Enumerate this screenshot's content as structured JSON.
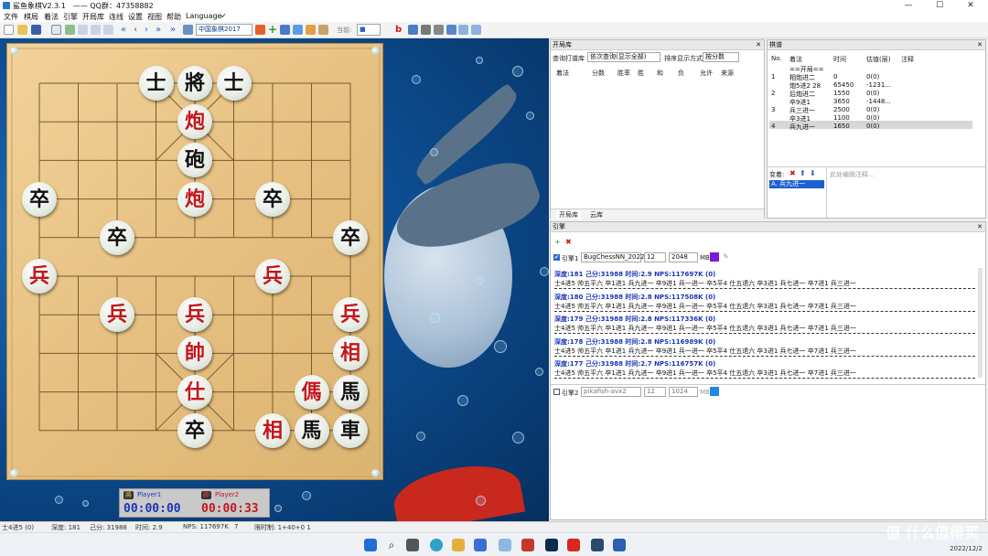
{
  "window": {
    "title": "鲨鱼象棋V2.3.1　——  QQ群：47358882",
    "minimize": "—",
    "maximize": "☐",
    "close": "✕"
  },
  "menu": [
    "文件",
    "棋局",
    "着法",
    "引擎",
    "开局库",
    "连线",
    "设置",
    "视图",
    "帮助",
    "Language"
  ],
  "toolbar": {
    "book_select": "中国象棋2017",
    "note_label": "当前:"
  },
  "board": {
    "pieces": [
      {
        "char": "士",
        "color": "black",
        "col": 3,
        "row": 0
      },
      {
        "char": "將",
        "color": "black",
        "col": 4,
        "row": 0
      },
      {
        "char": "士",
        "color": "black",
        "col": 5,
        "row": 0
      },
      {
        "char": "炮",
        "color": "red",
        "col": 4,
        "row": 1
      },
      {
        "char": "砲",
        "color": "black",
        "col": 4,
        "row": 2
      },
      {
        "char": "炮",
        "color": "red",
        "col": 4,
        "row": 3
      },
      {
        "char": "卒",
        "color": "black",
        "col": 0,
        "row": 3
      },
      {
        "char": "卒",
        "color": "black",
        "col": 6,
        "row": 3
      },
      {
        "char": "卒",
        "color": "black",
        "col": 2,
        "row": 4
      },
      {
        "char": "卒",
        "color": "black",
        "col": 8,
        "row": 4
      },
      {
        "char": "兵",
        "color": "red",
        "col": 0,
        "row": 5
      },
      {
        "char": "兵",
        "color": "red",
        "col": 6,
        "row": 5
      },
      {
        "char": "兵",
        "color": "red",
        "col": 2,
        "row": 6
      },
      {
        "char": "兵",
        "color": "red",
        "col": 4,
        "row": 6
      },
      {
        "char": "兵",
        "color": "red",
        "col": 8,
        "row": 6
      },
      {
        "char": "帥",
        "color": "red",
        "col": 4,
        "row": 7
      },
      {
        "char": "相",
        "color": "red",
        "col": 8,
        "row": 7
      },
      {
        "char": "仕",
        "color": "red",
        "col": 4,
        "row": 8
      },
      {
        "char": "傌",
        "color": "red",
        "col": 7,
        "row": 8
      },
      {
        "char": "馬",
        "color": "black",
        "col": 8,
        "row": 8
      },
      {
        "char": "卒",
        "color": "black",
        "col": 4,
        "row": 9
      },
      {
        "char": "相",
        "color": "red",
        "col": 6,
        "row": 9
      },
      {
        "char": "馬",
        "color": "black",
        "col": 7,
        "row": 9
      },
      {
        "char": "車",
        "color": "black",
        "col": 8,
        "row": 9
      }
    ]
  },
  "clocks": {
    "black_tag": "將",
    "black_name": "Player1",
    "black_time": "00:00:00",
    "red_tag": "帥",
    "red_name": "Player2",
    "red_time": "00:00:33"
  },
  "opening_panel": {
    "title": "开局库",
    "query_label": "查询打谱库",
    "query_mode": "依次查询(显示全部)",
    "sort_label": "排序显示方式",
    "sort_mode": "按分数",
    "columns": [
      "着法",
      "分数",
      "胜率",
      "胜",
      "和",
      "负",
      "允许",
      "来源"
    ],
    "tabs": [
      "开局库",
      "云库"
    ]
  },
  "manual_panel": {
    "title": "棋谱",
    "columns": [
      "No.",
      "着法",
      "时间",
      "估值(层)",
      "注释"
    ],
    "rows": [
      {
        "no": "",
        "move": "==开局==",
        "time": "",
        "eval": ""
      },
      {
        "no": "1",
        "move": "相炮进二",
        "time": "0",
        "eval": "0(0)"
      },
      {
        "no": "",
        "move": "炮5进2  28",
        "time": "65450",
        "eval": "-1231..."
      },
      {
        "no": "2",
        "move": "后炮进二",
        "time": "1550",
        "eval": "0(0)"
      },
      {
        "no": "",
        "move": "卒9进1",
        "time": "3650",
        "eval": "-1448..."
      },
      {
        "no": "3",
        "move": "兵三进一",
        "time": "2500",
        "eval": "0(0)"
      },
      {
        "no": "",
        "move": "卒3进1",
        "time": "1100",
        "eval": "0(0)"
      },
      {
        "no": "4",
        "move": "兵九进一",
        "time": "1650",
        "eval": "0(0)"
      }
    ],
    "variation_label": "变着:",
    "variation_item": "A. 兵九进一",
    "comment_placeholder": "此处编辑注释..."
  },
  "engine_panel": {
    "title": "引擎",
    "engine1": {
      "label": "引擎1",
      "name": "BugChessNN_2022",
      "threads": "12",
      "hash": "2048",
      "unit": "MB"
    },
    "engine2": {
      "label": "引擎2",
      "name": "pikafish-avx2",
      "threads": "12",
      "hash": "1024",
      "unit": "MB"
    },
    "lines": [
      {
        "info": "深度:181  己分:31988  时间:2.9  NPS:117697K  (0)",
        "pv": "士4进5  帅五平六  卒1进1  兵九进一  卒9进1  兵一进一  卒5平4  仕五退六  卒3进1  兵七进一  卒7进1  兵三进一"
      },
      {
        "info": "深度:180  己分:31988  时间:2.8  NPS:117508K  (0)",
        "pv": "士4进5  帅五平六  卒1进1  兵九进一  卒9进1  兵一进一  卒5平4  仕五退六  卒3进1  兵七进一  卒7进1  兵三进一"
      },
      {
        "info": "深度:179  己分:31988  时间:2.8  NPS:117336K  (0)",
        "pv": "士4进5  帅五平六  卒1进1  兵九进一  卒9进1  兵一进一  卒5平4  仕五退六  卒3进1  兵七进一  卒7进1  兵三进一"
      },
      {
        "info": "深度:178  己分:31988  时间:2.8  NPS:116989K  (0)",
        "pv": "士4进5  帅五平六  卒1进1  兵九进一  卒9进1  兵一进一  卒5平4  仕五退六  卒3进1  兵七进一  卒7进1  兵三进一"
      },
      {
        "info": "深度:177  己分:31988  时间:2.7  NPS:116757K  (0)",
        "pv": "士4进5  帅五平六  卒1进1  兵九进一  卒9进1  兵一进一  卒5平4  仕五退六  卒3进1  兵七进一  卒7进1  兵三进一"
      }
    ]
  },
  "status": {
    "move": "士4进5 (0)",
    "depth": "深度: 181",
    "score": "己分: 31988",
    "time": "时间: 2.9",
    "nps": "NPS: 117697K",
    "count": "7",
    "limit": "限时制: 1+40+0 1"
  },
  "taskbar": {
    "date": "2022/12/2",
    "watermark": "值 什么值得买"
  },
  "colors": {
    "red_piece": "#c4161c",
    "depth_text": "#1a35b8",
    "board": "#e6c081"
  }
}
